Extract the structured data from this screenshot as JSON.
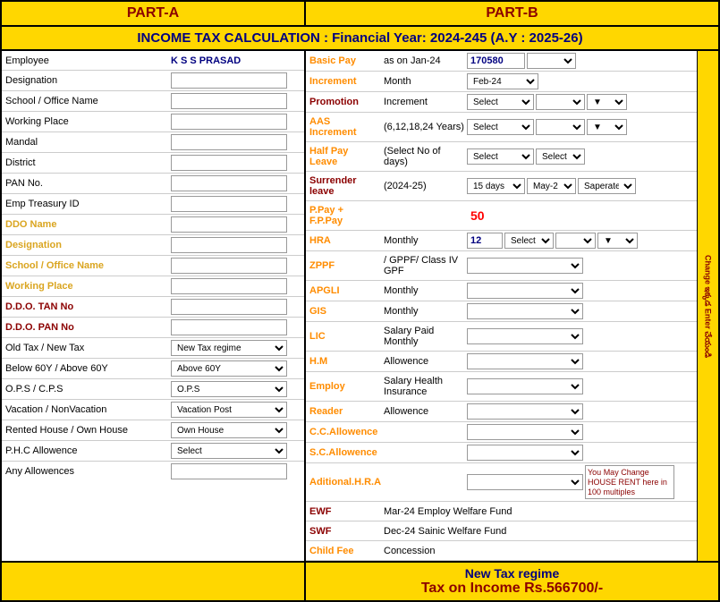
{
  "header": {
    "partA_label": "PART-A",
    "partB_label": "PART-B",
    "title": "INCOME TAX CALCULATION : Financial Year: 2024-245    (A.Y : 2025-26)"
  },
  "partA": {
    "fields": [
      {
        "label": "Employee",
        "value": "K S S PRASAD",
        "type": "text",
        "color": "blue"
      },
      {
        "label": "Designation",
        "value": "",
        "type": "text",
        "color": "normal"
      },
      {
        "label": "School / Office Name",
        "value": "",
        "type": "text",
        "color": "normal"
      },
      {
        "label": "Working Place",
        "value": "",
        "type": "text",
        "color": "normal"
      },
      {
        "label": "Mandal",
        "value": "",
        "type": "text",
        "color": "normal"
      },
      {
        "label": "District",
        "value": "",
        "type": "text",
        "color": "normal"
      },
      {
        "label": "PAN No.",
        "value": "",
        "type": "text",
        "color": "normal"
      },
      {
        "label": "Emp Treasury ID",
        "value": "",
        "type": "text",
        "color": "normal"
      },
      {
        "label": "DDO Name",
        "value": "",
        "type": "text",
        "color": "gold"
      },
      {
        "label": "Designation",
        "value": "",
        "type": "text",
        "color": "gold"
      },
      {
        "label": "School / Office Name",
        "value": "",
        "type": "text",
        "color": "gold"
      },
      {
        "label": "Working Place",
        "value": "",
        "type": "text",
        "color": "gold"
      },
      {
        "label": "D.D.O. TAN No",
        "value": "",
        "type": "text",
        "color": "red"
      },
      {
        "label": "D.D.O. PAN No",
        "value": "",
        "type": "text",
        "color": "red"
      },
      {
        "label": "Old Tax  /  New Tax",
        "value": "New Tax regime",
        "type": "dropdown",
        "color": "normal"
      },
      {
        "label": "Below 60Y  /  Above 60Y",
        "value": "Above 60Y",
        "type": "dropdown",
        "color": "normal"
      },
      {
        "label": "O.P.S  /  C.P.S",
        "value": "O.P.S",
        "type": "dropdown",
        "color": "normal"
      },
      {
        "label": "Vacation  /  NonVacation",
        "value": "Vacation Post",
        "type": "dropdown",
        "color": "normal"
      },
      {
        "label": "Rented House / Own House",
        "value": "Own House",
        "type": "dropdown",
        "color": "normal"
      },
      {
        "label": "P.H.C Allowence",
        "value": "Select",
        "type": "dropdown",
        "color": "normal"
      },
      {
        "label": "Any Allowences",
        "value": "",
        "type": "text",
        "color": "normal"
      }
    ]
  },
  "partB": {
    "rows": [
      {
        "key": "basic_pay",
        "label": "Basic Pay",
        "sublabel": "as on Jan-24",
        "control_type": "num+dropdown",
        "num_value": "170580",
        "dropdown_value": "",
        "label_color": "orange"
      },
      {
        "key": "increment",
        "label": "Increment",
        "sublabel": "Month",
        "control_type": "dropdown",
        "dropdown_value": "Feb-24",
        "label_color": "orange"
      },
      {
        "key": "promotion",
        "label": "Promotion",
        "sublabel": "Increment",
        "control_type": "dropdown2",
        "dropdown_value": "Select",
        "label_color": "p-red"
      },
      {
        "key": "aas",
        "label": "AAS Increment",
        "sublabel": "(6,12,18,24 Years)",
        "control_type": "dropdown2",
        "dropdown_value": "Select",
        "label_color": "orange"
      },
      {
        "key": "half_pay",
        "label": "Half Pay Leave",
        "sublabel": "(Select No of days)",
        "control_type": "dropdown3",
        "dropdown_value": "Select",
        "label_color": "orange"
      },
      {
        "key": "surrender",
        "label": "Surrender leave",
        "sublabel": "(2024-25)",
        "control_type": "surrender",
        "d1": "15 days",
        "d2": "May-2",
        "d3": "Saperate",
        "label_color": "p-red"
      },
      {
        "key": "ppay",
        "label": "P.Pay + F.P.Pay",
        "sublabel": "",
        "control_type": "highlight50",
        "label_color": "orange"
      },
      {
        "key": "hra",
        "label": "HRA",
        "sublabel": "Monthly",
        "control_type": "num+dropdown2",
        "num_value": "12",
        "label_color": "orange"
      },
      {
        "key": "zppf",
        "label": "ZPPF",
        "sublabel": "/ GPPF/ Class IV GPF",
        "control_type": "dropdown_only",
        "label_color": "orange"
      },
      {
        "key": "apgli",
        "label": "APGLI",
        "sublabel": "Monthly",
        "control_type": "dropdown_only",
        "label_color": "orange"
      },
      {
        "key": "gis",
        "label": "GIS",
        "sublabel": "Monthly",
        "control_type": "dropdown_only",
        "label_color": "orange"
      },
      {
        "key": "lic",
        "label": "LIC",
        "sublabel": "Salary Paid Monthly",
        "control_type": "dropdown_only",
        "label_color": "orange"
      },
      {
        "key": "hm",
        "label": "H.M",
        "sublabel": "Allowence",
        "control_type": "dropdown_only",
        "label_color": "orange"
      },
      {
        "key": "employ",
        "label": "Employ",
        "sublabel": "Salary Health Insurance",
        "control_type": "dropdown_only",
        "label_color": "orange"
      },
      {
        "key": "reader",
        "label": "Reader",
        "sublabel": "Allowence",
        "control_type": "dropdown_only",
        "label_color": "orange"
      },
      {
        "key": "cc",
        "label": "C.C.Allowence",
        "sublabel": "",
        "control_type": "dropdown_only",
        "label_color": "orange"
      },
      {
        "key": "sc",
        "label": "S.C.Allowence",
        "sublabel": "",
        "control_type": "dropdown_only",
        "label_color": "orange"
      },
      {
        "key": "ahra",
        "label": "Aditional.H.R.A",
        "sublabel": "",
        "control_type": "dropdown_with_note",
        "label_color": "orange"
      },
      {
        "key": "ewf",
        "label": "EWF",
        "sublabel": "Mar-24 Employ Welfare Fund",
        "control_type": "none",
        "label_color": "p-red"
      },
      {
        "key": "swf",
        "label": "SWF",
        "sublabel": "Dec-24 Sainic Welfare Fund",
        "control_type": "none",
        "label_color": "p-red"
      },
      {
        "key": "child",
        "label": "Child Fee",
        "sublabel": "Concession",
        "control_type": "none",
        "label_color": "orange"
      }
    ],
    "side_label": "Change ఇక్కడ Enter చేయండి"
  },
  "footer": {
    "tax_regime": "New Tax regime",
    "tax_label": "Tax on Income  Rs.566700/-"
  }
}
